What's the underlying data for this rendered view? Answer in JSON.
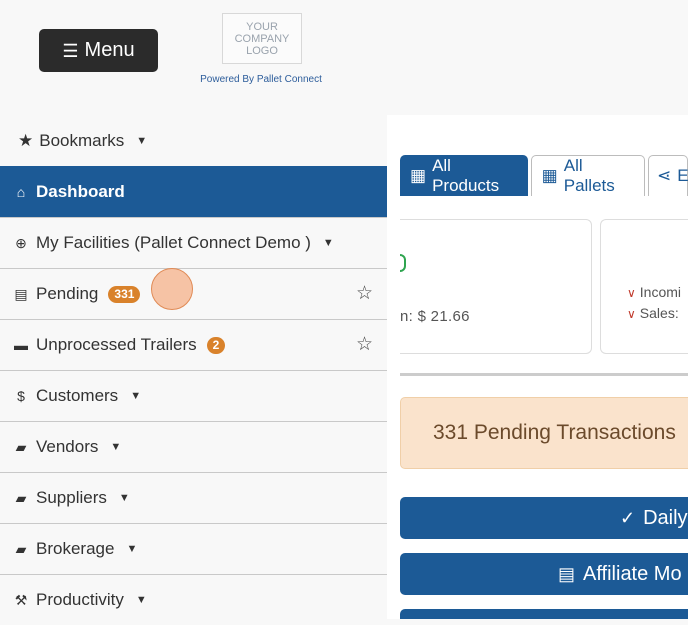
{
  "header": {
    "menu_label": "Menu",
    "logo_text": "YOUR\nCOMPANY\nLOGO",
    "powered_by": "Powered By Pallet Connect"
  },
  "sidebar": {
    "bookmarks_label": "Bookmarks",
    "items": [
      {
        "label": "Dashboard",
        "icon": "home-icon"
      },
      {
        "label": "My Facilities (Pallet Connect Demo )",
        "icon": "globe-icon"
      },
      {
        "label": "Pending",
        "icon": "clipboard-icon",
        "badge": "331"
      },
      {
        "label": "Unprocessed Trailers",
        "icon": "trailer-icon",
        "badge": "2"
      },
      {
        "label": "Customers",
        "icon": "dollar-icon"
      },
      {
        "label": "Vendors",
        "icon": "truck-icon"
      },
      {
        "label": "Suppliers",
        "icon": "truck-loading-icon"
      },
      {
        "label": "Brokerage",
        "icon": "truck-moving-icon"
      },
      {
        "label": "Productivity",
        "icon": "hammer-icon"
      }
    ]
  },
  "main": {
    "tabs": [
      {
        "label": "All Products",
        "icon": "pallet-icon"
      },
      {
        "label": "All Pallets",
        "icon": "pallet-icon"
      },
      {
        "label": "E",
        "icon": "share-icon"
      }
    ],
    "card1": {
      "avg_text": "n: $ 21.66"
    },
    "card2": {
      "row1": "Incomi",
      "row2": "Sales:"
    },
    "pending_alert": "331 Pending Transactions",
    "buttons": [
      {
        "label": "Daily",
        "icon": "check-icon"
      },
      {
        "label": "Affiliate Mo",
        "icon": "list-icon"
      }
    ]
  },
  "colors": {
    "primary": "#1c5a96",
    "badge": "#d9822b",
    "alert_bg": "#fae3cc",
    "menu_bg": "#2b2b2b"
  }
}
